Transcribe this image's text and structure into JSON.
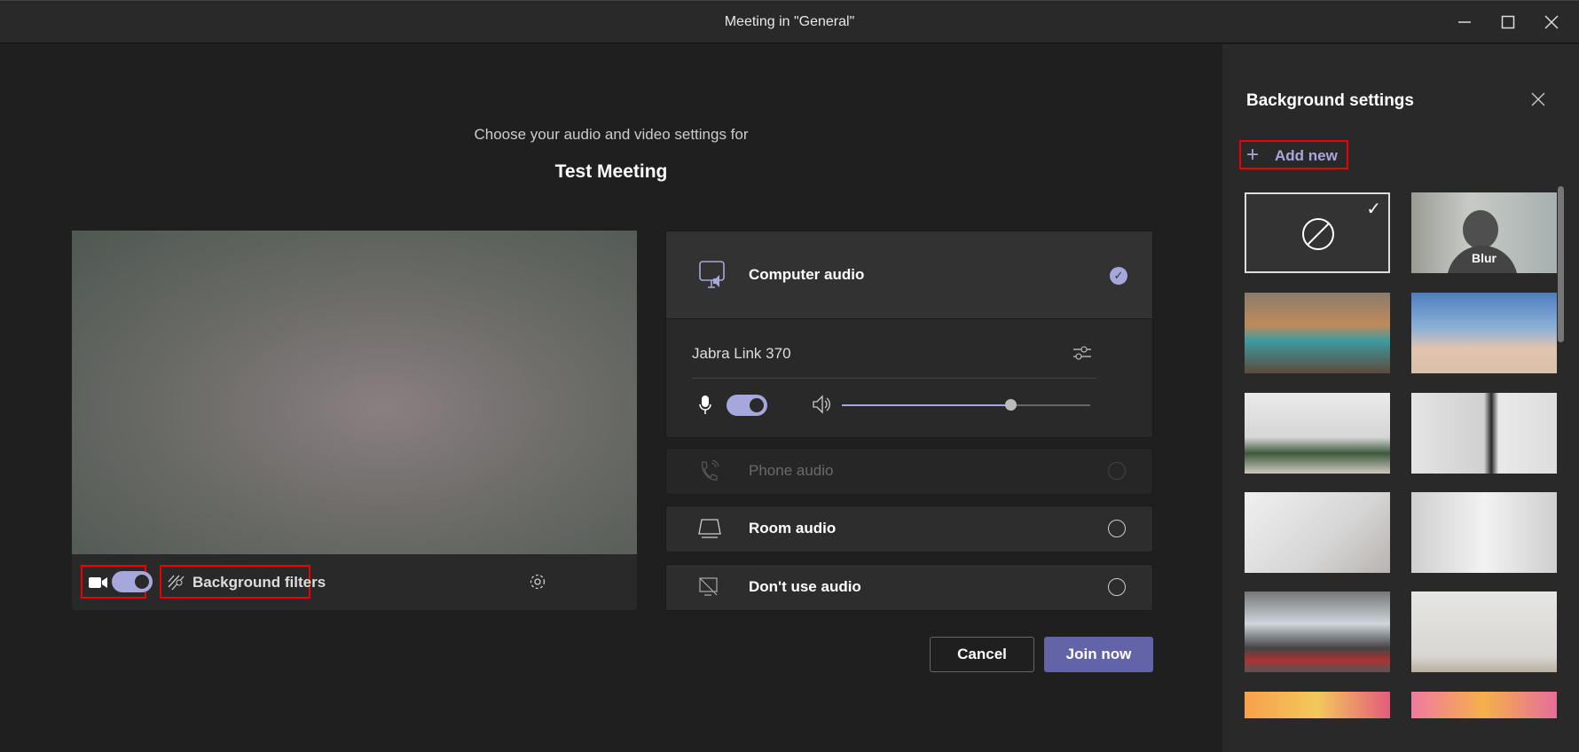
{
  "window": {
    "title": "Meeting in \"General\""
  },
  "prejoin": {
    "subtitle": "Choose your audio and video settings for",
    "meeting_name": "Test Meeting"
  },
  "video_toolbar": {
    "camera_on": true,
    "background_filters_label": "Background filters"
  },
  "audio": {
    "options": [
      {
        "label": "Computer audio",
        "selected": true,
        "enabled": true,
        "icon": "computer-speaker-icon"
      },
      {
        "label": "Phone audio",
        "selected": false,
        "enabled": false,
        "icon": "phone-icon"
      },
      {
        "label": "Room audio",
        "selected": false,
        "enabled": true,
        "icon": "room-device-icon"
      },
      {
        "label": "Don't use audio",
        "selected": false,
        "enabled": true,
        "icon": "no-audio-icon"
      }
    ],
    "device": "Jabra Link 370",
    "mic_on": true,
    "volume_percent": 68
  },
  "actions": {
    "cancel": "Cancel",
    "join": "Join now"
  },
  "colors": {
    "accent": "#6264a7",
    "accent_light": "#a6a7dc",
    "highlight": "#e00000"
  },
  "background_panel": {
    "title": "Background settings",
    "add_new": "Add new",
    "tiles": [
      {
        "label": "",
        "type": "none",
        "selected": true
      },
      {
        "label": "Blur",
        "type": "blur"
      },
      {
        "label": ""
      },
      {
        "label": ""
      },
      {
        "label": ""
      },
      {
        "label": ""
      },
      {
        "label": ""
      },
      {
        "label": ""
      },
      {
        "label": ""
      },
      {
        "label": ""
      },
      {
        "label": ""
      },
      {
        "label": ""
      }
    ]
  }
}
